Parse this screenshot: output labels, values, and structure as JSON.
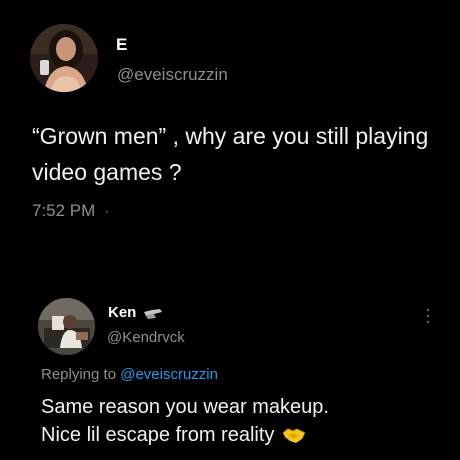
{
  "main_tweet": {
    "display_name": "E",
    "handle": "@eveiscruzzin",
    "text": "“Grown men” , why are you still playing video games ?",
    "time": "7:52 PM",
    "time_separator": "·"
  },
  "reply": {
    "display_name": "Ken",
    "handle": "@Kendrvck",
    "replying_prefix": "Replying to",
    "replying_to": "@eveiscruzzin",
    "text_line1": "Same reason you wear makeup.",
    "text_line2": "Nice lil escape from reality",
    "emoji": "handshake-icon"
  },
  "colors": {
    "background": "#000000",
    "primary_text": "#f0f0f0",
    "secondary_text": "#8b8f93",
    "link": "#1d9bf0"
  }
}
